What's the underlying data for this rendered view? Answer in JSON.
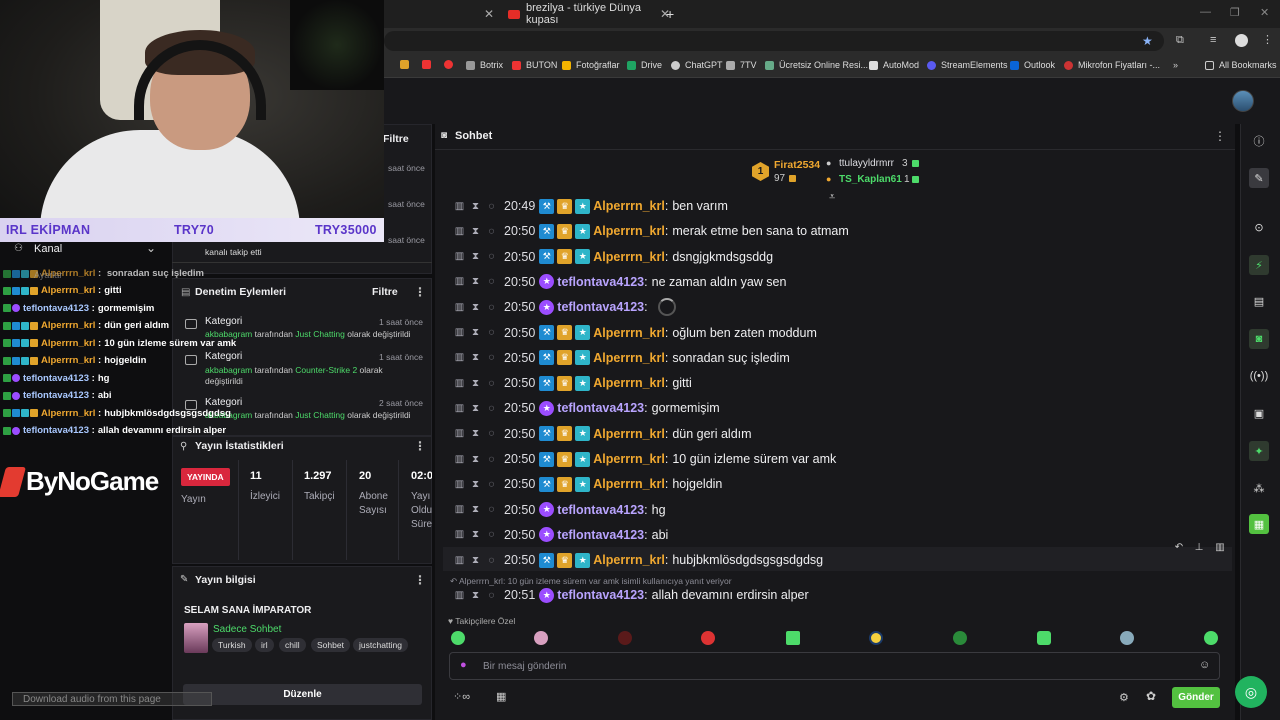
{
  "browser": {
    "active_tab_title": "brezilya - türkiye Dünya kupası",
    "new_tab": "+",
    "bookmarks": [
      {
        "label": "Botrix",
        "color": "#999"
      },
      {
        "label": "BUTON",
        "color": "#e33"
      },
      {
        "label": "Fotoğraflar",
        "color": "#f4b400"
      },
      {
        "label": "Drive",
        "color": "#1fa463"
      },
      {
        "label": "ChatGPT",
        "color": "#ccc"
      },
      {
        "label": "7TV",
        "color": "#aaa"
      },
      {
        "label": "Ücretsiz Online Resi...",
        "color": "#6a8"
      },
      {
        "label": "AutoMod",
        "color": "#ddd"
      },
      {
        "label": "StreamElements",
        "color": "#5a5af0"
      },
      {
        "label": "Outlook",
        "color": "#0a64d6"
      },
      {
        "label": "Mikrofon Fiyatları -...",
        "color": "#c33"
      }
    ],
    "all_bookmarks": "All Bookmarks"
  },
  "overlay": {
    "donate_label": "IRL EKİPMAN",
    "donate_current": "TRY70",
    "donate_goal": "TRY35000",
    "donate_progress": 0.002,
    "brand": "ByNoGame",
    "download_audio": "Download audio from this page"
  },
  "left_chat": [
    {
      "user": "Alperrrn_krl",
      "color": "orange",
      "msg": "gitti"
    },
    {
      "user": "teflontava4123",
      "color": "blue",
      "msg": "gormemişim"
    },
    {
      "user": "Alperrrn_krl",
      "color": "orange",
      "msg": "dün geri aldım"
    },
    {
      "user": "Alperrrn_krl",
      "color": "orange",
      "msg": "10 gün izleme sürem var amk"
    },
    {
      "user": "Alperrrn_krl",
      "color": "orange",
      "msg": "hojgeldin"
    },
    {
      "user": "teflontava4123",
      "color": "blue",
      "msg": "hg"
    },
    {
      "user": "teflontava4123",
      "color": "blue",
      "msg": "abi"
    },
    {
      "user": "Alperrrn_krl",
      "color": "orange",
      "msg": "hubjbkmlösdgdsgsgsdgdsg"
    },
    {
      "user": "teflontava4123",
      "color": "blue",
      "msg": "allah devamını erdirsin alper"
    }
  ],
  "left_chat_partial": "sonradan suç işledim",
  "left_chat_partial_user": "Alperrrn_krl",
  "dashboard": {
    "kanal_label": "Kanal",
    "ayarlar": "Ayarlar",
    "filtre": "Filtre",
    "saat_once": "saat önce",
    "follow_text": "kanalı takip etti",
    "mod_actions_title": "Denetim Eylemleri",
    "mod_actions_filter": "Filtre",
    "mod_actions": [
      {
        "title": "Kategori",
        "time": "1 saat önce",
        "user": "akbabagram",
        "mid": " tarafından ",
        "cat": "Just Chatting",
        "end": " olarak değiştirildi"
      },
      {
        "title": "Kategori",
        "time": "1 saat önce",
        "user": "akbabagram",
        "mid": " tarafından ",
        "cat": "Counter-Strike 2",
        "end": " olarak değiştirildi"
      },
      {
        "title": "Kategori",
        "time": "2 saat önce",
        "user": "akbabagram",
        "mid": " tarafından ",
        "cat": "Just Chatting",
        "end": " olarak değiştirildi"
      }
    ],
    "stats_title": "Yayın İstatistikleri",
    "live_badge": "YAYINDA",
    "live_label": "Yayın",
    "stats": [
      {
        "value": "11",
        "label": "İzleyici"
      },
      {
        "value": "1.297",
        "label": "Takipçi"
      },
      {
        "value": "20",
        "label": "Abone Sayısı"
      },
      {
        "value": "02:0",
        "label": "Yayı Oldu Süre"
      }
    ],
    "info_title": "Yayın bilgisi",
    "stream_title": "SELAM SANA İMPARATOR",
    "category": "Sadece Sohbet",
    "tags": [
      "Turkish",
      "irl",
      "chill",
      "Sohbet",
      "justchatting"
    ],
    "edit_button": "Düzenle"
  },
  "chat": {
    "title": "Sohbet",
    "leaderboard": {
      "rank": "1",
      "top_user": "Firat2534",
      "top_points": "97",
      "second_user": "ttulayyldrmrr",
      "second_count": "3",
      "third_user": "TS_Kaplan61",
      "third_count": "1"
    },
    "messages": [
      {
        "time": "20:49",
        "user": "Alperrrn_krl",
        "type": "o",
        "text": "ben varım"
      },
      {
        "time": "20:50",
        "user": "Alperrrn_krl",
        "type": "o",
        "text": "merak etme ben sana to atmam"
      },
      {
        "time": "20:50",
        "user": "Alperrrn_krl",
        "type": "o",
        "text": "dsngjgkmdsgsddg"
      },
      {
        "time": "20:50",
        "user": "teflontava4123",
        "type": "p",
        "text": "ne zaman aldın yaw sen"
      },
      {
        "time": "20:50",
        "user": "teflontava4123",
        "type": "p",
        "text": ""
      },
      {
        "time": "20:50",
        "user": "Alperrrn_krl",
        "type": "o",
        "text": "oğlum ben zaten moddum"
      },
      {
        "time": "20:50",
        "user": "Alperrrn_krl",
        "type": "o",
        "text": "sonradan suç işledim"
      },
      {
        "time": "20:50",
        "user": "Alperrrn_krl",
        "type": "o",
        "text": "gitti"
      },
      {
        "time": "20:50",
        "user": "teflontava4123",
        "type": "p",
        "text": "gormemişim"
      },
      {
        "time": "20:50",
        "user": "Alperrrn_krl",
        "type": "o",
        "text": "dün geri aldım"
      },
      {
        "time": "20:50",
        "user": "Alperrrn_krl",
        "type": "o",
        "text": "10 gün izleme sürem var amk"
      },
      {
        "time": "20:50",
        "user": "Alperrrn_krl",
        "type": "o",
        "text": "hojgeldin"
      },
      {
        "time": "20:50",
        "user": "teflontava4123",
        "type": "p",
        "text": "hg"
      },
      {
        "time": "20:50",
        "user": "teflontava4123",
        "type": "p",
        "text": "abi"
      },
      {
        "time": "20:50",
        "user": "Alperrrn_krl",
        "type": "o",
        "text": "hubjbkmlösdgdsgsgsdgdsg"
      }
    ],
    "reply_note": "Alperrrn_krl: 10 gün izleme sürem var amk isimli kullanıcıya yanıt veriyor",
    "reply_msg": {
      "time": "20:51",
      "user": "teflontava4123",
      "text": "allah devamını erdirsin alper"
    },
    "followers_only": "Takipçilere Özel",
    "input_placeholder": "Bir mesaj gönderin",
    "send_button": "Gönder"
  }
}
